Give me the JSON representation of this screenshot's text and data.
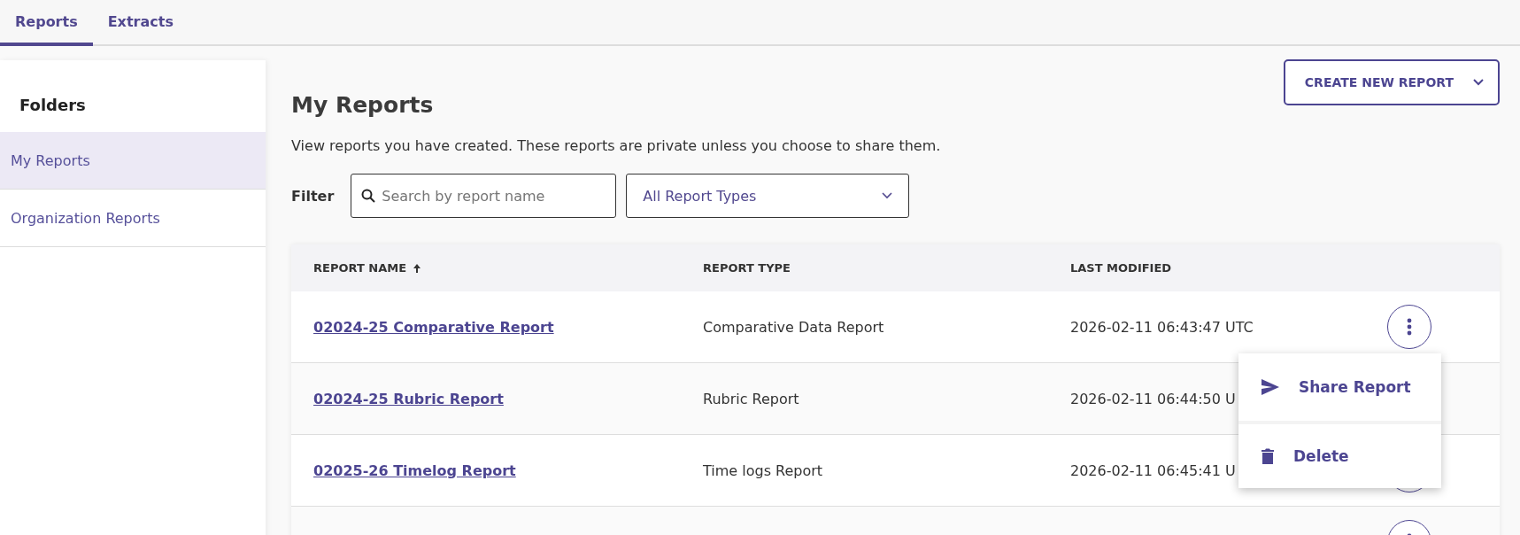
{
  "tabs": [
    {
      "label": "Reports",
      "selected": true
    },
    {
      "label": "Extracts",
      "selected": false
    }
  ],
  "sidebar": {
    "title": "Folders",
    "items": [
      {
        "label": "My Reports",
        "selected": true
      },
      {
        "label": "Organization Reports",
        "selected": false
      }
    ]
  },
  "page": {
    "title": "My Reports",
    "description": "View reports you have created. These reports are private unless you choose to share them.",
    "create_button": "CREATE NEW REPORT"
  },
  "filter": {
    "label": "Filter",
    "search": {
      "placeholder": "Search by report name"
    },
    "type_select": "All Report Types"
  },
  "table": {
    "columns": [
      {
        "label": "REPORT NAME",
        "sorted": true
      },
      {
        "label": "REPORT TYPE",
        "sorted": false
      },
      {
        "label": "LAST MODIFIED",
        "sorted": false
      }
    ],
    "rows": [
      {
        "name": "02024-25 Comparative Report",
        "type": "Comparative Data Report",
        "modified": "2026-02-11 06:43:47 UTC"
      },
      {
        "name": "02024-25 Rubric Report",
        "type": "Rubric Report",
        "modified": "2026-02-11 06:44:50 U"
      },
      {
        "name": "02025-26 Timelog Report",
        "type": "Time logs Report",
        "modified": "2026-02-11 06:45:41 U"
      },
      {}
    ]
  },
  "menu": {
    "items": [
      {
        "kind": "share",
        "label": "Share Report"
      },
      {
        "kind": "delete",
        "label": "Delete"
      }
    ]
  }
}
